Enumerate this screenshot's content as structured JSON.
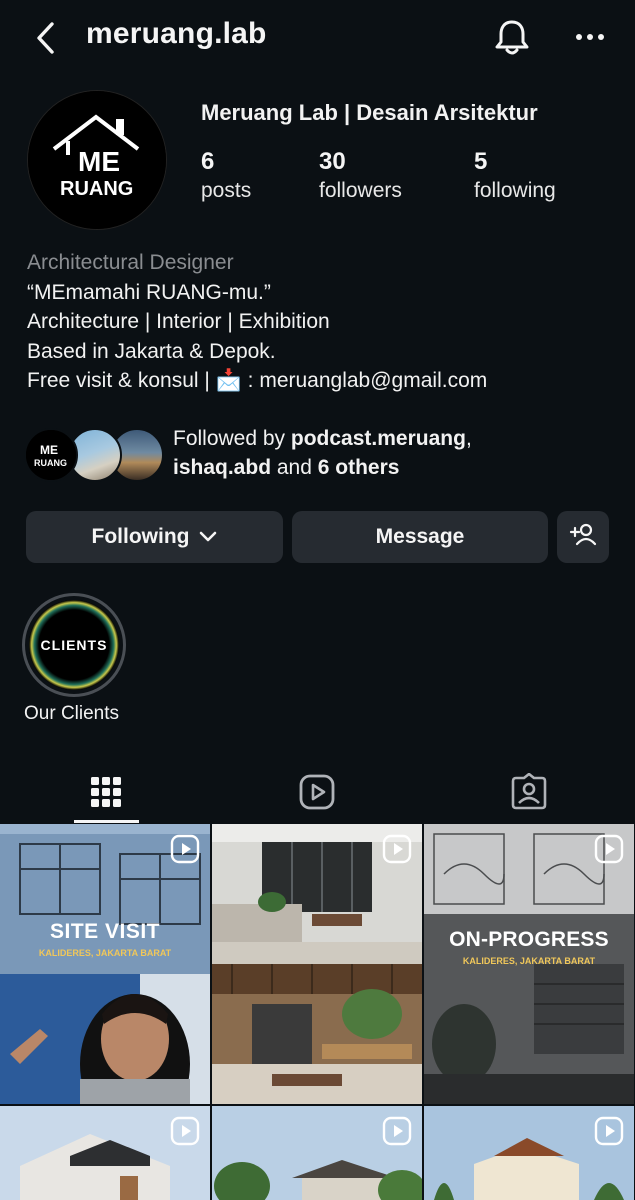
{
  "header": {
    "username": "meruang.lab"
  },
  "profile": {
    "display_name": "Meruang Lab | Desain Arsitektur",
    "avatar_text": [
      "ME",
      "RUANG"
    ],
    "stats": [
      {
        "value": "6",
        "label": "posts"
      },
      {
        "value": "30",
        "label": "followers"
      },
      {
        "value": "5",
        "label": "following"
      }
    ]
  },
  "bio": {
    "category": "Architectural Designer",
    "lines": [
      "“MEmamahi RUANG-mu.”",
      "Architecture | Interior | Exhibition",
      "Based in Jakarta & Depok.",
      "Free visit & konsul | 📩 : meruanglab@gmail.com"
    ]
  },
  "mutual": {
    "prefix": "Followed by ",
    "user1": "podcast.meruang",
    "sep": ",",
    "user2": "ishaq.abd",
    "and": " and ",
    "others": "6 others"
  },
  "actions": {
    "following_label": "Following",
    "message_label": "Message"
  },
  "highlights": [
    {
      "label": "Our Clients",
      "cover_text": "CLIENTS"
    }
  ],
  "posts": [
    {
      "title": "SITE VISIT",
      "subtitle": "KALIDERES, JAKARTA BARAT"
    },
    {
      "title": "",
      "subtitle": ""
    },
    {
      "title": "ON-PROGRESS",
      "subtitle": "KALIDERES, JAKARTA BARAT"
    }
  ],
  "colors": {
    "background": "#0b1014",
    "button": "#262b31",
    "muted_text": "#8a8d91",
    "highlight_ring": "#4a4f55"
  }
}
